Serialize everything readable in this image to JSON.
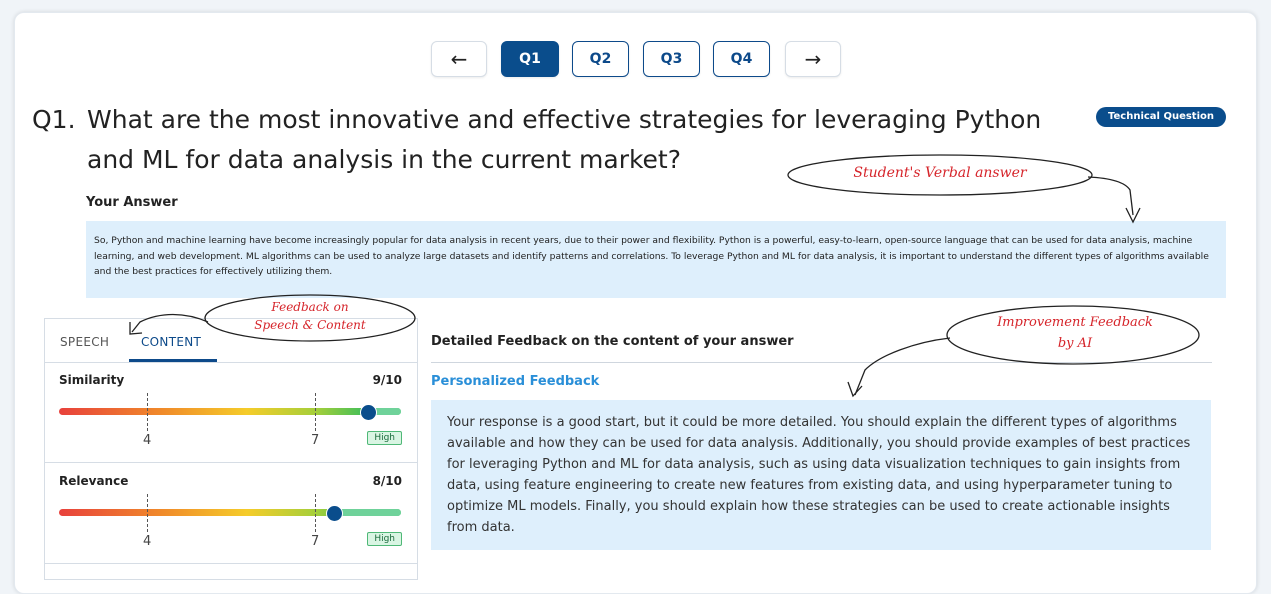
{
  "nav": {
    "prev_icon": "←",
    "next_icon": "→",
    "questions": [
      "Q1",
      "Q2",
      "Q3",
      "Q4"
    ],
    "active": "Q1"
  },
  "question": {
    "number": "Q1.",
    "text": "What are the most innovative and effective strategies for leveraging Python and ML for data analysis in the current market?",
    "badge": "Technical Question"
  },
  "answer": {
    "label": "Your Answer",
    "text": "So, Python and machine learning have become increasingly popular for data analysis in recent years, due to their power and flexibility. Python is a powerful, easy-to-learn, open-source language that can be used for data analysis, machine learning, and web development. ML algorithms can be used to analyze large datasets and identify patterns and correlations. To leverage Python and ML for data analysis, it is important to understand the different types of algorithms available and the best practices for effectively utilizing them."
  },
  "tabs": {
    "speech": "SPEECH",
    "content": "CONTENT",
    "active": "CONTENT"
  },
  "metrics": [
    {
      "name": "Similarity",
      "score": "9/10",
      "value_fraction": 0.9,
      "tick_low": "4",
      "tick_high": "7",
      "level": "High"
    },
    {
      "name": "Relevance",
      "score": "8/10",
      "value_fraction": 0.8,
      "tick_low": "4",
      "tick_high": "7",
      "level": "High"
    }
  ],
  "feedback": {
    "title": "Detailed Feedback on the content of your answer",
    "subtitle": "Personalized Feedback",
    "text": "Your response is a good start, but it could be more detailed. You should explain the different types of algorithms available and how they can be used for data analysis. Additionally, you should provide examples of best practices for leveraging Python and ML for data analysis, such as using data visualization techniques to gain insights from data, using feature engineering to create new features from existing data, and using hyperparameter tuning to optimize ML models. Finally, you should explain how these strategies can be used to create actionable insights from data."
  },
  "annotations": {
    "verbal": "Student's Verbal answer",
    "speech_content_1": "Feedback on",
    "speech_content_2": "Speech & Content",
    "improvement_1": "Improvement Feedback",
    "improvement_2": "by AI"
  },
  "colors": {
    "primary": "#0a4d8c",
    "accent_link": "#2a8fd8",
    "answer_bg": "#deeffc",
    "annotation": "#d6252b",
    "level_bg": "#d9f5e3"
  }
}
